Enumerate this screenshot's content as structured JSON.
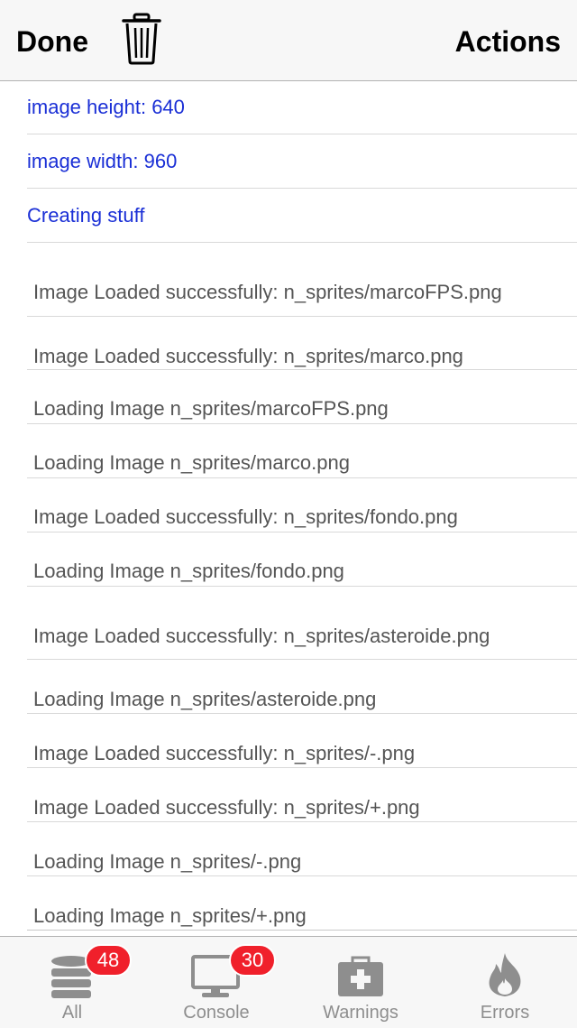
{
  "navbar": {
    "done_label": "Done",
    "actions_label": "Actions",
    "trash_icon": "trash-icon"
  },
  "log": {
    "info_items": [
      "image height: 640",
      "image width: 960",
      "Creating stuff"
    ],
    "entries": [
      "Image Loaded successfully: n_sprites/marcoFPS.png",
      "Image Loaded successfully: n_sprites/marco.png",
      "Loading Image n_sprites/marcoFPS.png",
      "Loading Image n_sprites/marco.png",
      "Image Loaded successfully: n_sprites/fondo.png",
      "Loading Image n_sprites/fondo.png",
      "Image Loaded successfully: n_sprites/asteroide.png",
      "Loading Image n_sprites/asteroide.png",
      "Image Loaded successfully: n_sprites/-.png",
      "Image Loaded successfully: n_sprites/+.png",
      "Loading Image n_sprites/-.png",
      "Loading Image n_sprites/+.png"
    ]
  },
  "tabs": [
    {
      "label": "All",
      "badge": "48",
      "icon": "database-icon"
    },
    {
      "label": "Console",
      "badge": "30",
      "icon": "monitor-icon"
    },
    {
      "label": "Warnings",
      "icon": "first-aid-kit-icon"
    },
    {
      "label": "Errors",
      "icon": "fire-icon"
    }
  ],
  "colors": {
    "info_text": "#1a2fd6",
    "entry_text": "#555555",
    "badge": "#f0202b",
    "tab_icon": "#8e8e8e"
  }
}
